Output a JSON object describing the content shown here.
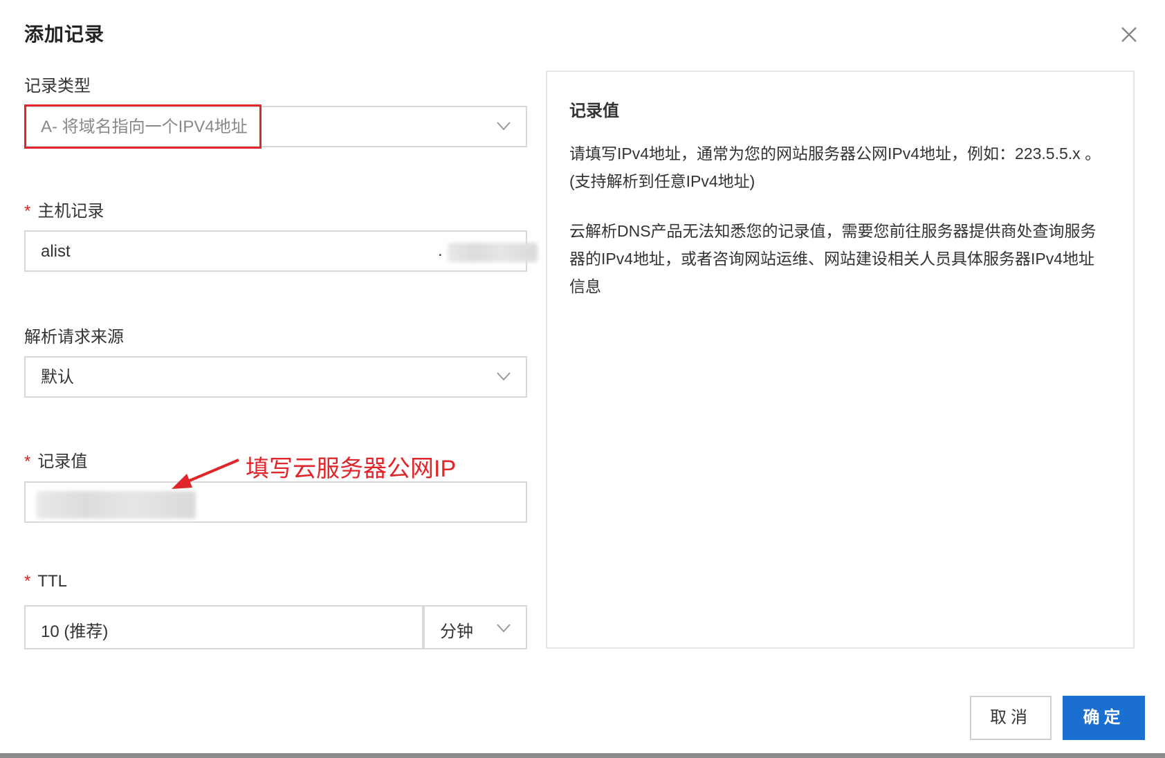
{
  "dialog": {
    "title": "添加记录",
    "close_icon": "close-icon"
  },
  "record_type": {
    "label": "记录类型",
    "value": "A- 将域名指向一个IPV4地址"
  },
  "host_record": {
    "required_mark": "*",
    "label": "主机记录",
    "value": "alist",
    "domain_suffix": "."
  },
  "resolve_source": {
    "label": "解析请求来源",
    "value": "默认"
  },
  "record_value": {
    "required_mark": "*",
    "label": "记录值",
    "annotation": "填写云服务器公网IP"
  },
  "ttl": {
    "required_mark": "*",
    "label": "TTL",
    "value": "10 (推荐)",
    "unit": "分钟"
  },
  "help_panel": {
    "title": "记录值",
    "paragraph1": "请填写IPv4地址，通常为您的网站服务器公网IPv4地址，例如：223.5.5.x 。(支持解析到任意IPv4地址)",
    "paragraph2": "云解析DNS产品无法知悉您的记录值，需要您前往服务器提供商处查询服务器的IPv4地址，或者咨询网站运维、网站建设相关人员具体服务器IPv4地址信息"
  },
  "buttons": {
    "cancel": "取消",
    "confirm": "确定"
  },
  "colors": {
    "primary": "#1a6fd0",
    "highlight_red": "#e0262b",
    "required_red": "#e02020"
  }
}
